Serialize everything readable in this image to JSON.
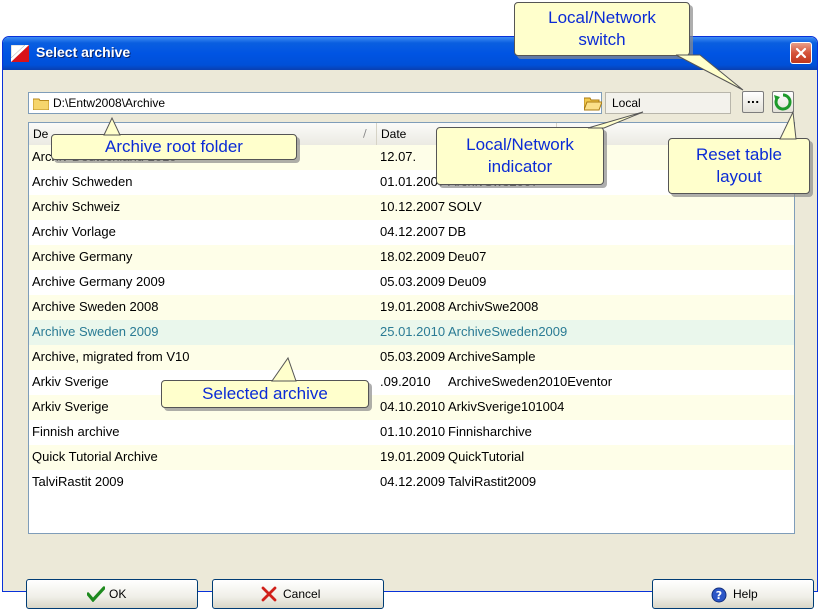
{
  "window": {
    "title": "Select archive"
  },
  "toolbar": {
    "path": "D:\\Entw2008\\Archive",
    "mode": "Local",
    "switch_label": "..."
  },
  "table": {
    "columns": [
      "Description",
      "Date",
      ""
    ],
    "columns_visible": [
      "De",
      "Date",
      ""
    ],
    "rows": [
      [
        "Archiv Deutschland 2010",
        "12.07.",
        ""
      ],
      [
        "Archiv Schweden",
        "01.01.2007",
        "ArchivSwe2007"
      ],
      [
        "Archiv Schweiz",
        "10.12.2007",
        "SOLV"
      ],
      [
        "Archiv Vorlage",
        "04.12.2007",
        "DB"
      ],
      [
        "Archive Germany",
        "18.02.2009",
        "Deu07"
      ],
      [
        "Archive Germany 2009",
        "05.03.2009",
        "Deu09"
      ],
      [
        "Archive Sweden 2008",
        "19.01.2008",
        "ArchivSwe2008"
      ],
      [
        "Archive Sweden 2009",
        "25.01.2010",
        "ArchiveSweden2009"
      ],
      [
        "Archive, migrated from V10",
        "05.03.2009",
        "ArchiveSample"
      ],
      [
        "Arkiv Sverige",
        ".09.2010",
        "ArchiveSweden2010Eventor"
      ],
      [
        "Arkiv Sverige",
        "04.10.2010",
        "ArkivSverige101004"
      ],
      [
        "Finnish archive",
        "01.10.2010",
        "Finnisharchive"
      ],
      [
        "Quick Tutorial Archive",
        "19.01.2009",
        "QuickTutorial"
      ],
      [
        "TalviRastit 2009",
        "04.12.2009",
        "TalviRastit2009"
      ]
    ],
    "selected_index": 7
  },
  "buttons": {
    "ok": "OK",
    "cancel": "Cancel",
    "help": "Help"
  },
  "callouts": {
    "switch_line1": "Local/Network",
    "switch_line2": "switch",
    "root_folder": "Archive root folder",
    "indicator_line1": "Local/Network",
    "indicator_line2": "indicator",
    "reset_line1": "Reset table",
    "reset_line2": "layout",
    "selected": "Selected archive"
  },
  "icons": [
    "app-icon",
    "close-icon",
    "folder-icon",
    "browse-folder-icon",
    "refresh-icon",
    "check-icon",
    "x-icon",
    "help-icon"
  ],
  "colors": {
    "titlebar": "#0054e3",
    "callout_bg": "#ffffcc",
    "callout_text": "#0b2bd6",
    "selected_row_text": "#2a7b94"
  }
}
